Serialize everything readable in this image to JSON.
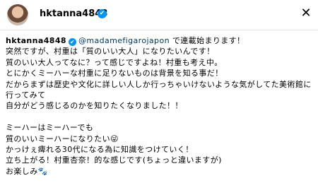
{
  "header": {
    "username": "hktanna4848",
    "verified_icon": "✔",
    "close_icon": "✕"
  },
  "caption": {
    "username": "hktanna4848",
    "verified_icon": "✔",
    "mention": "@madamefigarojapon",
    "body": " で連載始まります！\n突然ですが、村重は「質のいい大人」になりたいんです！\n質のいい大人ってなに？って感じですよね！村重も考え中。\nとにかくミーハーな村重に足りないものは背景を知る事だ！\nだからまずは歴史や文化に詳しい人しか行っちゃいけないような気がしてた美術館に行ってみて\n自分がどう感じるのかを知りたくなりました！！\n\nミーハーはミーハーでも\n質のいいミーハーになりたい😜\nかっけぇ痺れる30代になる為に知識をつけていく！\n立ち上がる！村重杏奈！的な感じです(ちょっと違いますが)\nお楽しみ🐾"
  }
}
